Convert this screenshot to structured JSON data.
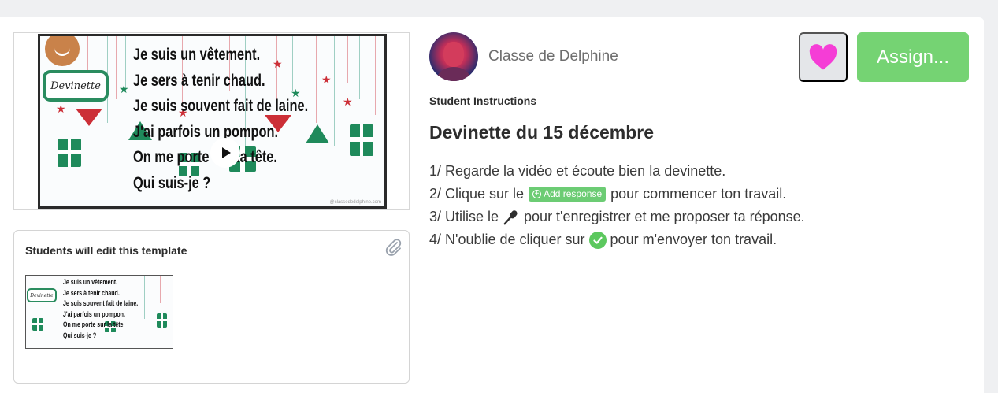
{
  "author": {
    "name": "Classe de Delphine"
  },
  "actions": {
    "favorite_icon": "heart-icon",
    "assign_label": "Assign..."
  },
  "colors": {
    "assign": "#75d373",
    "heart": "#f53dd6",
    "pill": "#6ccc74",
    "check": "#5cc85e"
  },
  "video": {
    "tag_text": "Devinette",
    "lines": [
      "Je suis un vêtement.",
      "Je sers à tenir chaud.",
      "Je suis souvent fait de laine.",
      "J'ai parfois un pompon.",
      "On me porte sur la tête.",
      "Qui suis-je ?"
    ],
    "credit": "@classededelphine.com",
    "play_icon": "play-icon"
  },
  "template": {
    "title": "Students will edit this template",
    "attachment_icon": "paperclip-icon"
  },
  "instructions": {
    "label": "Student Instructions",
    "title": "Devinette du 15 décembre",
    "line1": "1/ Regarde la vidéo et écoute bien la devinette.",
    "line2_pre": "2/ Clique sur le",
    "line2_pill": "Add response",
    "line2_post": "pour commencer ton travail.",
    "line3_pre": "3/ Utilise le",
    "line3_icon": "microphone-icon",
    "line3_post": "pour t'enregistrer et me proposer ta réponse.",
    "line4_pre": "4/ N'oublie de cliquer sur",
    "line4_icon": "check-circle-icon",
    "line4_post": "pour m'envoyer ton travail."
  }
}
